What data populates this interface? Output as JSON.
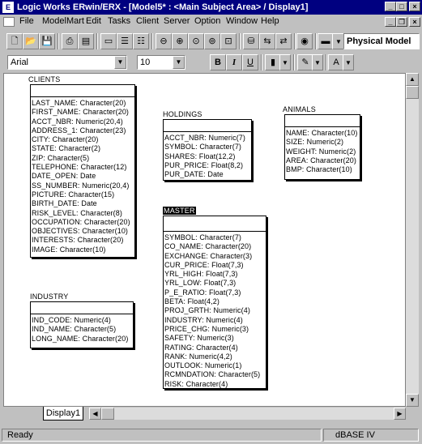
{
  "window": {
    "app_icon": "erwin-app-icon",
    "title": "Logic Works ERwin/ERX - [Model5* : <Main Subject Area> / Display1]",
    "controls": [
      "minimize",
      "maximize",
      "close"
    ]
  },
  "menubar": {
    "items": [
      "File",
      "ModelMart",
      "Edit",
      "Tasks",
      "Client",
      "Server",
      "Option",
      "Window",
      "Help"
    ],
    "underline": [
      "F",
      "M",
      "E",
      "T",
      "C",
      "S",
      "O",
      "W",
      "H"
    ]
  },
  "toolbar": {
    "model_view": "Physical Model",
    "font_name": "Arial",
    "font_size": "10",
    "bold": "B",
    "italic": "I",
    "underline": "U"
  },
  "diagram": {
    "entities": [
      {
        "name": "CLIENTS",
        "attributes": [
          "LAST_NAME: Character(20)",
          "FIRST_NAME: Character(20)",
          "ACCT_NBR: Numeric(20,4)",
          "ADDRESS_1: Character(23)",
          "CITY: Character(20)",
          "STATE: Character(2)",
          "ZIP: Character(5)",
          "TELEPHONE: Character(12)",
          "DATE_OPEN: Date",
          "SS_NUMBER: Numeric(20,4)",
          "PICTURE: Character(15)",
          "BIRTH_DATE: Date",
          "RISK_LEVEL: Character(8)",
          "OCCUPATION: Character(20)",
          "OBJECTIVES: Character(10)",
          "INTERESTS: Character(20)",
          "IMAGE: Character(10)"
        ]
      },
      {
        "name": "HOLDINGS",
        "attributes": [
          "ACCT_NBR: Numeric(7)",
          "SYMBOL: Character(7)",
          "SHARES: Float(12,2)",
          "PUR_PRICE: Float(8,2)",
          "PUR_DATE: Date"
        ]
      },
      {
        "name": "ANIMALS",
        "attributes": [
          "NAME: Character(10)",
          "SIZE: Numeric(2)",
          "WEIGHT: Numeric(2)",
          "AREA: Character(20)",
          "BMP: Character(10)"
        ]
      },
      {
        "name": "MASTER",
        "selected": true,
        "attributes": [
          "SYMBOL: Character(7)",
          "CO_NAME: Character(20)",
          "EXCHANGE: Character(3)",
          "CUR_PRICE: Float(7,3)",
          "YRL_HIGH: Float(7,3)",
          "YRL_LOW: Float(7,3)",
          "P_E_RATIO: Float(7,3)",
          "BETA: Float(4,2)",
          "PROJ_GRTH: Numeric(4)",
          "INDUSTRY: Numeric(4)",
          "PRICE_CHG: Numeric(3)",
          "SAFETY: Numeric(3)",
          "RATING: Character(4)",
          "RANK: Numeric(4,2)",
          "OUTLOOK: Numeric(1)",
          "RCMNDATION: Character(5)",
          "RISK: Character(4)"
        ]
      },
      {
        "name": "INDUSTRY",
        "attributes": [
          "IND_CODE: Numeric(4)",
          "IND_NAME: Character(5)",
          "LONG_NAME: Character(20)"
        ]
      }
    ]
  },
  "tabs": [
    "Display1"
  ],
  "status": {
    "left": "Ready",
    "right": "dBASE IV"
  }
}
